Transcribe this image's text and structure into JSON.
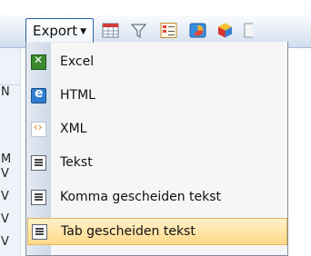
{
  "toolbar": {
    "export_label": "Export",
    "icons": [
      "table-grid-icon",
      "filter-icon",
      "list-icon",
      "chart-icon",
      "cube-icon",
      "overflow-icon"
    ]
  },
  "grid_fragment": {
    "letters": [
      "N",
      "M",
      "V",
      "V",
      "V",
      "V"
    ]
  },
  "export_menu": {
    "items": [
      {
        "label": "Excel",
        "icon": "excel-icon"
      },
      {
        "label": "HTML",
        "icon": "html-icon"
      },
      {
        "label": "XML",
        "icon": "xml-icon"
      },
      {
        "label": "Tekst",
        "icon": "text-file-icon"
      },
      {
        "label": "Komma gescheiden tekst",
        "icon": "text-file-icon"
      },
      {
        "label": "Tab gescheiden tekst",
        "icon": "text-file-icon",
        "highlighted": true
      }
    ]
  },
  "colors": {
    "toolbar_top": "#fbfcfe",
    "toolbar_bottom": "#d2dded",
    "menu_bg": "#f6f6f6",
    "highlight": "#ffd98a",
    "button_border": "#2d64a6"
  }
}
